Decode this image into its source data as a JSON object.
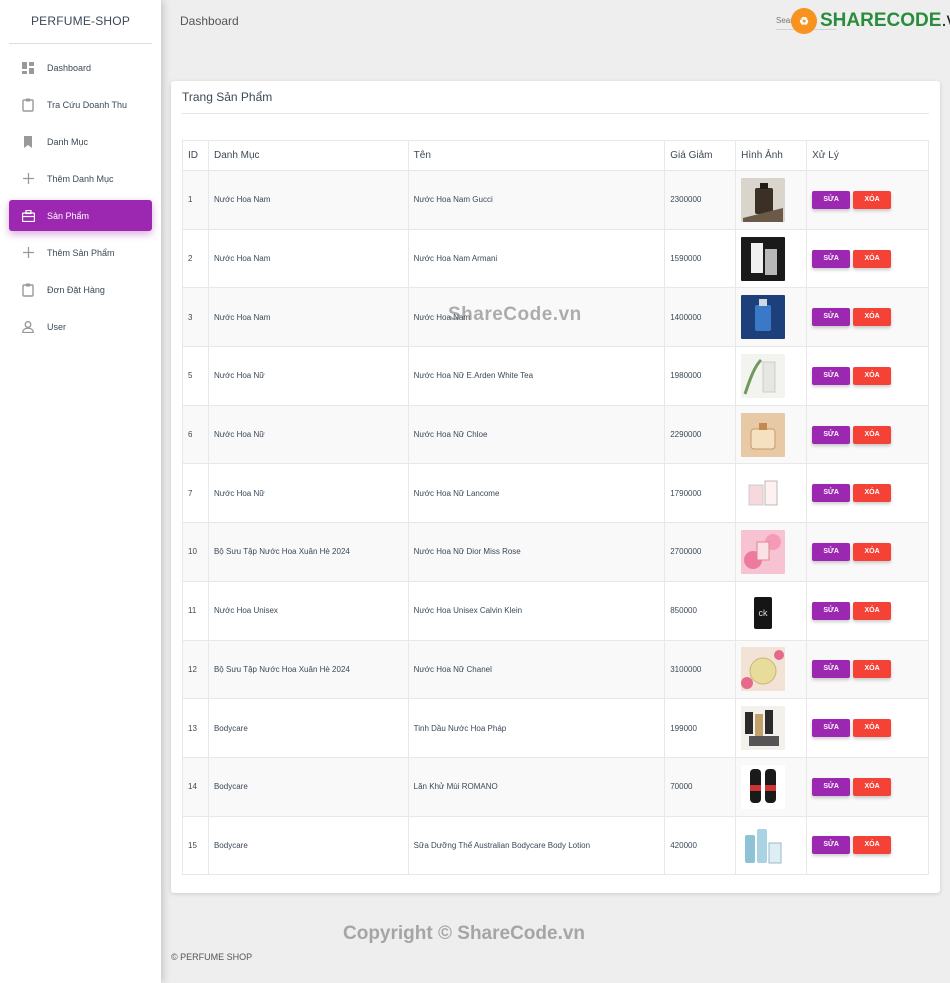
{
  "brand": "PERFUME-SHOP",
  "header": {
    "breadcrumb": "Dashboard",
    "search_placeholder": "Search"
  },
  "watermark": {
    "logo_text": "SHARECODE",
    "logo_suffix": ".vn",
    "center": "ShareCode.vn",
    "copyright": "Copyright © ShareCode.vn"
  },
  "sidebar": {
    "items": [
      {
        "label": "Dashboard",
        "icon": "dashboard-icon",
        "active": false
      },
      {
        "label": "Tra Cứu Doanh Thu",
        "icon": "clipboard-icon",
        "active": false
      },
      {
        "label": "Danh Mục",
        "icon": "bookmark-icon",
        "active": false
      },
      {
        "label": "Thêm Danh Mục",
        "icon": "plus-icon",
        "active": false
      },
      {
        "label": "Sản Phẩm",
        "icon": "store-icon",
        "active": true
      },
      {
        "label": "Thêm Sản Phẩm",
        "icon": "plus-icon",
        "active": false
      },
      {
        "label": "Đơn Đặt Hàng",
        "icon": "clipboard-icon",
        "active": false
      },
      {
        "label": "User",
        "icon": "user-icon",
        "active": false
      }
    ]
  },
  "card": {
    "title": "Trang Sản Phẩm"
  },
  "table": {
    "headers": {
      "id": "ID",
      "category": "Danh Mục",
      "name": "Tên",
      "price": "Giá Giảm",
      "image": "Hình Ảnh",
      "action": "Xử Lý"
    },
    "edit_label": "SỬA",
    "delete_label": "XÓA",
    "rows": [
      {
        "id": "1",
        "category": "Nước Hoa Nam",
        "name": "Nước Hoa Nam Gucci",
        "price": "2300000",
        "image": "perfume-gucci-image"
      },
      {
        "id": "2",
        "category": "Nước Hoa Nam",
        "name": "Nước Hoa Nam Armani",
        "price": "1590000",
        "image": "perfume-armani-image"
      },
      {
        "id": "3",
        "category": "Nước Hoa Nam",
        "name": "Nước Hoa Nam",
        "price": "1400000",
        "image": "perfume-blue-image"
      },
      {
        "id": "5",
        "category": "Nước Hoa Nữ",
        "name": "Nước Hoa Nữ E.Arden White Tea",
        "price": "1980000",
        "image": "perfume-white-tea-image"
      },
      {
        "id": "6",
        "category": "Nước Hoa Nữ",
        "name": "Nước Hoa Nữ Chloe",
        "price": "2290000",
        "image": "perfume-chloe-image"
      },
      {
        "id": "7",
        "category": "Nước Hoa Nữ",
        "name": "Nước Hoa Nữ Lancome",
        "price": "1790000",
        "image": "perfume-lancome-image"
      },
      {
        "id": "10",
        "category": "Bộ Sưu Tập Nước Hoa Xuân Hè 2024",
        "name": "Nước Hoa Nữ Dior Miss Rose",
        "price": "2700000",
        "image": "perfume-dior-image"
      },
      {
        "id": "11",
        "category": "Nước Hoa Unisex",
        "name": "Nước Hoa Unisex Calvin Klein",
        "price": "850000",
        "image": "perfume-ck-image"
      },
      {
        "id": "12",
        "category": "Bộ Sưu Tập Nước Hoa Xuân Hè 2024",
        "name": "Nước Hoa Nữ Chanel",
        "price": "3100000",
        "image": "perfume-chanel-image"
      },
      {
        "id": "13",
        "category": "Bodycare",
        "name": "Tinh Dầu Nước Hoa Pháp",
        "price": "199000",
        "image": "perfume-oil-image"
      },
      {
        "id": "14",
        "category": "Bodycare",
        "name": "Lăn Khử Mùi ROMANO",
        "price": "70000",
        "image": "deodorant-romano-image"
      },
      {
        "id": "15",
        "category": "Bodycare",
        "name": "Sữa Dưỡng Thể Australian Bodycare Body Lotion",
        "price": "420000",
        "image": "body-lotion-image"
      }
    ]
  },
  "footer": {
    "text": "© PERFUME SHOP"
  },
  "colors": {
    "accent": "#9c27b0",
    "danger": "#f44336",
    "background": "#eeeeee"
  }
}
